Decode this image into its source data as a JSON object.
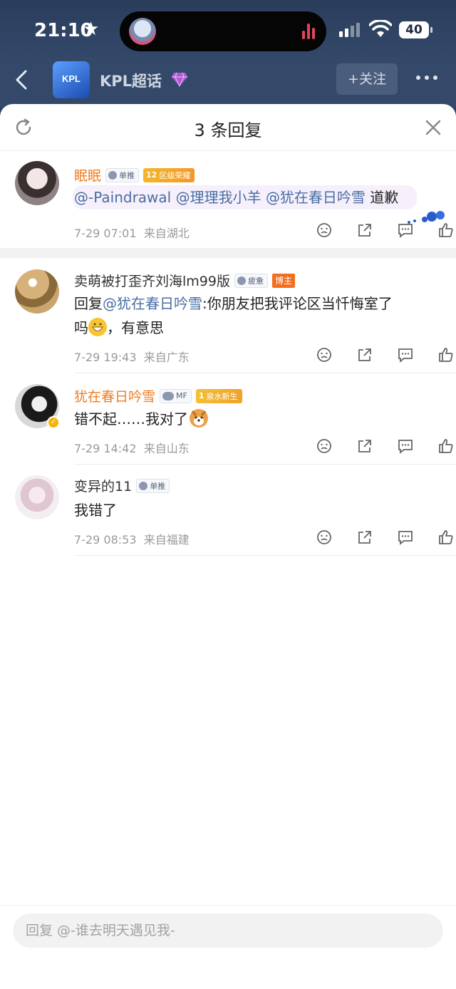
{
  "status_bar": {
    "time": "21:10",
    "battery": "40"
  },
  "nav": {
    "title": "KPL超话",
    "logo_text": "KPL",
    "follow_label": "+关注"
  },
  "sheet": {
    "title": "3 条回复",
    "reply_placeholder": "回复 @-谁去明天遇见我-"
  },
  "comments": [
    {
      "username": "眠眠",
      "badge": "单推",
      "level_num": "12",
      "level_label": "区级荣耀",
      "mentions": [
        "@-Paindrawal",
        "@理理我小羊",
        "@犹在春日吟雪"
      ],
      "text": "道歉",
      "time": "7-29 07:01",
      "location": "来自湖北"
    },
    {
      "username": "卖萌被打歪齐刘海lm99版",
      "badge": "疲惫",
      "host_badge": "博主",
      "reply_prefix": "回复",
      "reply_mention": "@犹在春日吟雪",
      "text_a": ":你朋友把我评论区当忏悔室了",
      "text_b": "吗",
      "text_c": "，有意思",
      "time": "7-29 19:43",
      "location": "来自广东"
    },
    {
      "username": "犹在春日吟雪",
      "badge": "MF",
      "level_num": "1",
      "level_label": "泉水新生",
      "text": "错不起……我对了",
      "time": "7-29 14:42",
      "location": "来自山东"
    },
    {
      "username": "变异的11",
      "badge": "单推",
      "text": "我错了",
      "time": "7-29 08:53",
      "location": "来自福建"
    }
  ],
  "colors": {
    "accent_orange": "#ef7b1f",
    "mention_blue": "#4a6da3",
    "nav_bg": "#34496a"
  }
}
